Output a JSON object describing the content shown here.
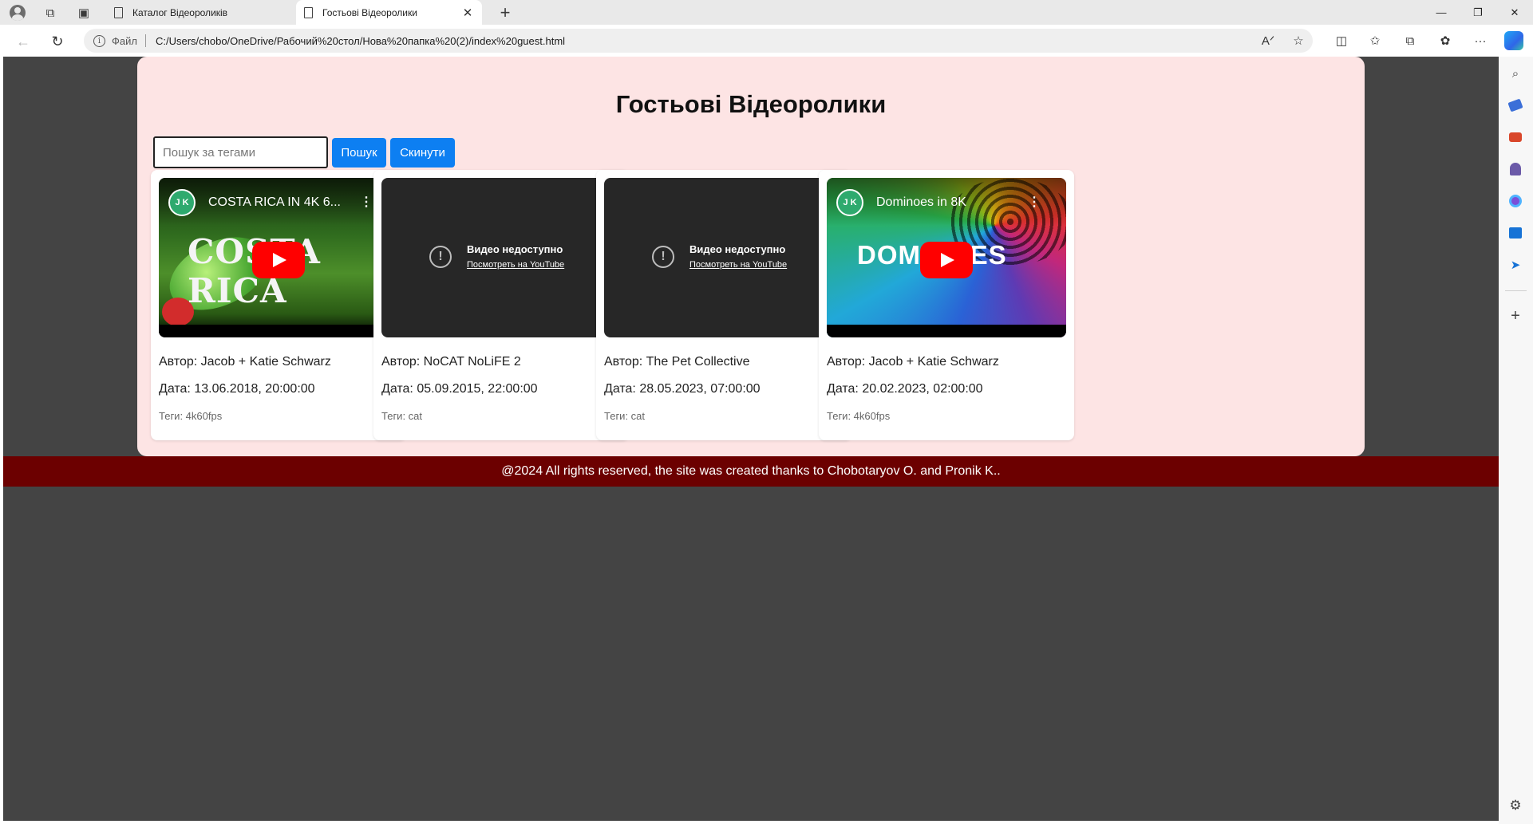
{
  "browser": {
    "tabs": [
      {
        "title": "Каталог Відеороликів"
      },
      {
        "title": "Гостьові Відеоролики"
      }
    ],
    "address": {
      "scheme_label": "Файл",
      "url": "C:/Users/chobo/OneDrive/Рабочий%20стол/Нова%20папка%20(2)/index%20guest.html"
    }
  },
  "page": {
    "heading": "Гостьові Відеоролики",
    "search": {
      "placeholder": "Пошук за тегами",
      "value": ""
    },
    "search_button": "Пошук",
    "reset_button": "Скинути",
    "videos": [
      {
        "embed_title": "COSTA RICA IN 4K 6...",
        "thumb_text": "COSTA RICA",
        "channel_initials": "J K",
        "author": "Автор: Jacob + Katie Schwarz",
        "date": "Дата: 13.06.2018, 20:00:00",
        "tags": "Теги: 4k60fps"
      },
      {
        "unavailable_title": "Видео недоступно",
        "unavailable_link": "Посмотреть на YouTube",
        "author": "Автор: NoCAT NoLiFE 2",
        "date": "Дата: 05.09.2015, 22:00:00",
        "tags": "Теги: cat"
      },
      {
        "unavailable_title": "Видео недоступно",
        "unavailable_link": "Посмотреть на YouTube",
        "author": "Автор: The Pet Collective",
        "date": "Дата: 28.05.2023, 07:00:00",
        "tags": "Теги: cat"
      },
      {
        "embed_title": "Dominoes in 8K",
        "thumb_text": "DOMINOES",
        "channel_initials": "J K",
        "author": "Автор: Jacob + Katie Schwarz",
        "date": "Дата: 20.02.2023, 02:00:00",
        "tags": "Теги: 4k60fps"
      }
    ],
    "footer": "@2024 All rights reserved, the site was created thanks to Chobotaryov O. and Pronik K.."
  },
  "colors": {
    "page_bg": "#444444",
    "container_bg": "#fde4e4",
    "button_bg": "#0d7ff2",
    "footer_bg": "#6c0000"
  }
}
